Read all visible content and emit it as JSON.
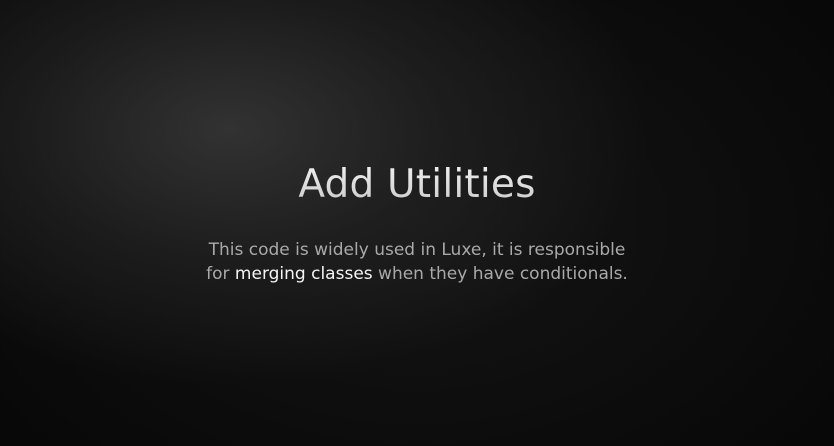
{
  "slide": {
    "title": "Add Utilities",
    "description": {
      "line1": "This code is widely used in Luxe, it is responsible",
      "line2_before": "for ",
      "line2_highlight": "merging classes",
      "line2_after": " when they have conditionals."
    }
  },
  "colors": {
    "background": "#000000",
    "title": "#d6d6d6",
    "body_text": "#a9a9a9",
    "highlight_text": "#f5f5f5"
  }
}
